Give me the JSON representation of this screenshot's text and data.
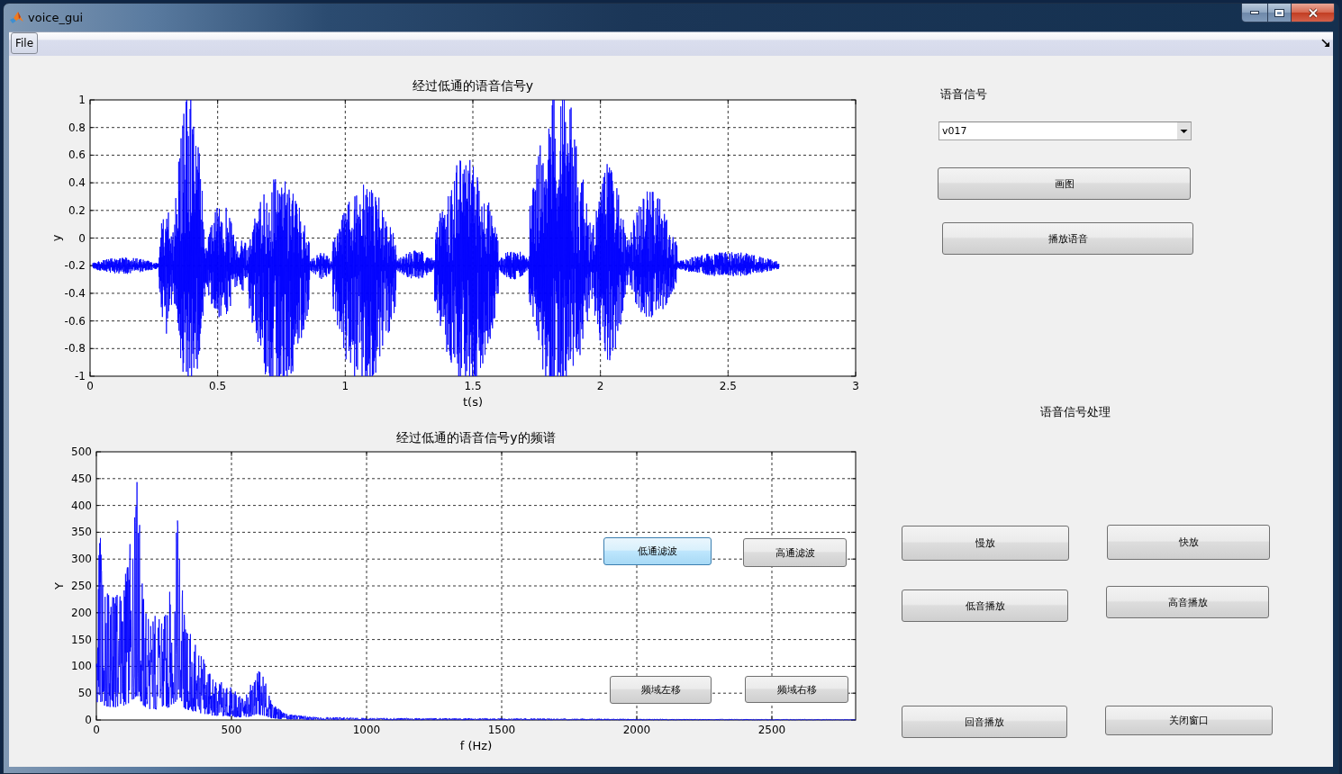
{
  "window": {
    "title": "voice_gui"
  },
  "menu": [
    {
      "label": "File"
    }
  ],
  "plots": [
    {
      "kind": "time",
      "title": "经过低通的语音信号y",
      "xlabel": "t(s)",
      "ylabel": "y",
      "xticks": [
        "0",
        "0.5",
        "1",
        "1.5",
        "2",
        "2.5",
        "3"
      ],
      "yticks": [
        "1",
        "0.8",
        "0.6",
        "0.4",
        "0.2",
        "0",
        "-0.2",
        "-0.4",
        "-0.6",
        "-0.8",
        "-1"
      ]
    },
    {
      "kind": "spectrum",
      "title": "经过低通的语音信号y的频谱",
      "xlabel": "f (Hz)",
      "ylabel": "Y",
      "xticks": [
        "0",
        "500",
        "1000",
        "1500",
        "2000",
        "2500"
      ],
      "yticks": [
        "500",
        "450",
        "400",
        "350",
        "300",
        "250",
        "200",
        "150",
        "100",
        "50",
        "0"
      ],
      "buttons": [
        {
          "label": "低通滤波",
          "hovered": true
        },
        {
          "label": "高通滤波",
          "hovered": false
        },
        {
          "label": "频域左移",
          "hovered": false
        },
        {
          "label": "频域右移",
          "hovered": false
        }
      ]
    }
  ],
  "signal_panel": {
    "label": "语音信号",
    "dropdown": {
      "value": "v017"
    },
    "buttons": [
      "画图",
      "播放语音"
    ]
  },
  "processing_panel": {
    "label": "语音信号处理",
    "buttons": [
      "慢放",
      "快放",
      "低音播放",
      "高音播放",
      "回音播放",
      "关闭窗口"
    ]
  }
}
